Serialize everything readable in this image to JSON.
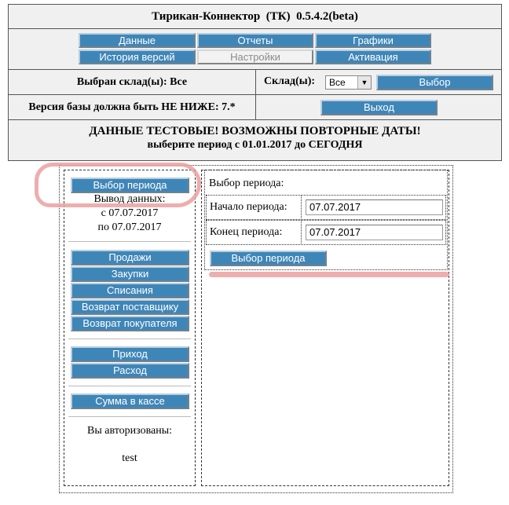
{
  "header": {
    "title": "Тирикан-Коннектор  (ТК)  0.5.4.2(beta)"
  },
  "nav": {
    "data": "Данные",
    "reports": "Отчеты",
    "charts": "Графики",
    "history": "История версий",
    "settings": "Настройки",
    "activation": "Активация"
  },
  "warehouse": {
    "selected": "Выбран склад(ы): Все",
    "label": "Склад(ы):",
    "select_value": "Все",
    "select_button": "Выбор"
  },
  "version": {
    "notice": "Версия базы должна быть НЕ НИЖЕ: 7.*",
    "exit_button": "Выход"
  },
  "banner": {
    "line1": "ДАННЫЕ ТЕСТОВЫЕ! ВОЗМОЖНЫ ПОВТОРНЫЕ ДАТЫ!",
    "line2": "выберите период с 01.01.2017 до СЕГОДНЯ"
  },
  "sidebar": {
    "period_button": "Выбор периода",
    "output_label": "Вывод данных:",
    "from_text": "с 07.07.2017",
    "to_text": "по 07.07.2017",
    "group1": [
      "Продажи",
      "Закупки",
      "Списания",
      "Возврат поставщику",
      "Возврат покупателя"
    ],
    "group2": [
      "Приход",
      "Расход"
    ],
    "group3": [
      "Сумма в кассе"
    ],
    "auth_label": "Вы авторизованы:",
    "user": "test"
  },
  "period_form": {
    "title": "Выбор периода:",
    "start_label": "Начало периода:",
    "start_value": "07.07.2017",
    "end_label": "Конец периода:",
    "end_value": "07.07.2017",
    "submit": "Выбор периода"
  },
  "colors": {
    "button": "#3f86b8",
    "annotation": "#e98b8b",
    "panel": "#f0f0f0"
  }
}
